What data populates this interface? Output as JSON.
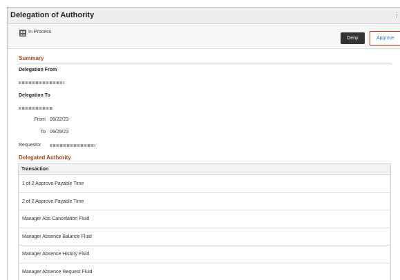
{
  "header": {
    "title": "Delegation of Authority"
  },
  "status": {
    "text": "In Process",
    "icon": "people-icon"
  },
  "actions": {
    "deny_label": "Deny",
    "approve_label": "Approve"
  },
  "summary": {
    "section_title": "Summary",
    "delegation_from_label": "Delegation From",
    "delegation_to_label": "Delegation To",
    "from_label": "From",
    "from_value": "09/22/23",
    "to_label": "To",
    "to_value": "09/29/23",
    "requestor_label": "Requestor"
  },
  "delegated_authority": {
    "section_title": "Delegated Authority",
    "column_header": "Transaction",
    "rows": [
      "1 of 2 Approve Payable Time",
      "2 of 2 Approve Payable Time",
      "Manager Abs Cancelation Fluid",
      "Manager Absence Balance Fluid",
      "Manager Absence History Fluid",
      "Manager Absence Request Fluid"
    ]
  },
  "colors": {
    "accent_section": "#9b4c1f",
    "approve_border": "#e0242a",
    "approve_text": "#2a74c8",
    "deny_bg": "#333333"
  }
}
